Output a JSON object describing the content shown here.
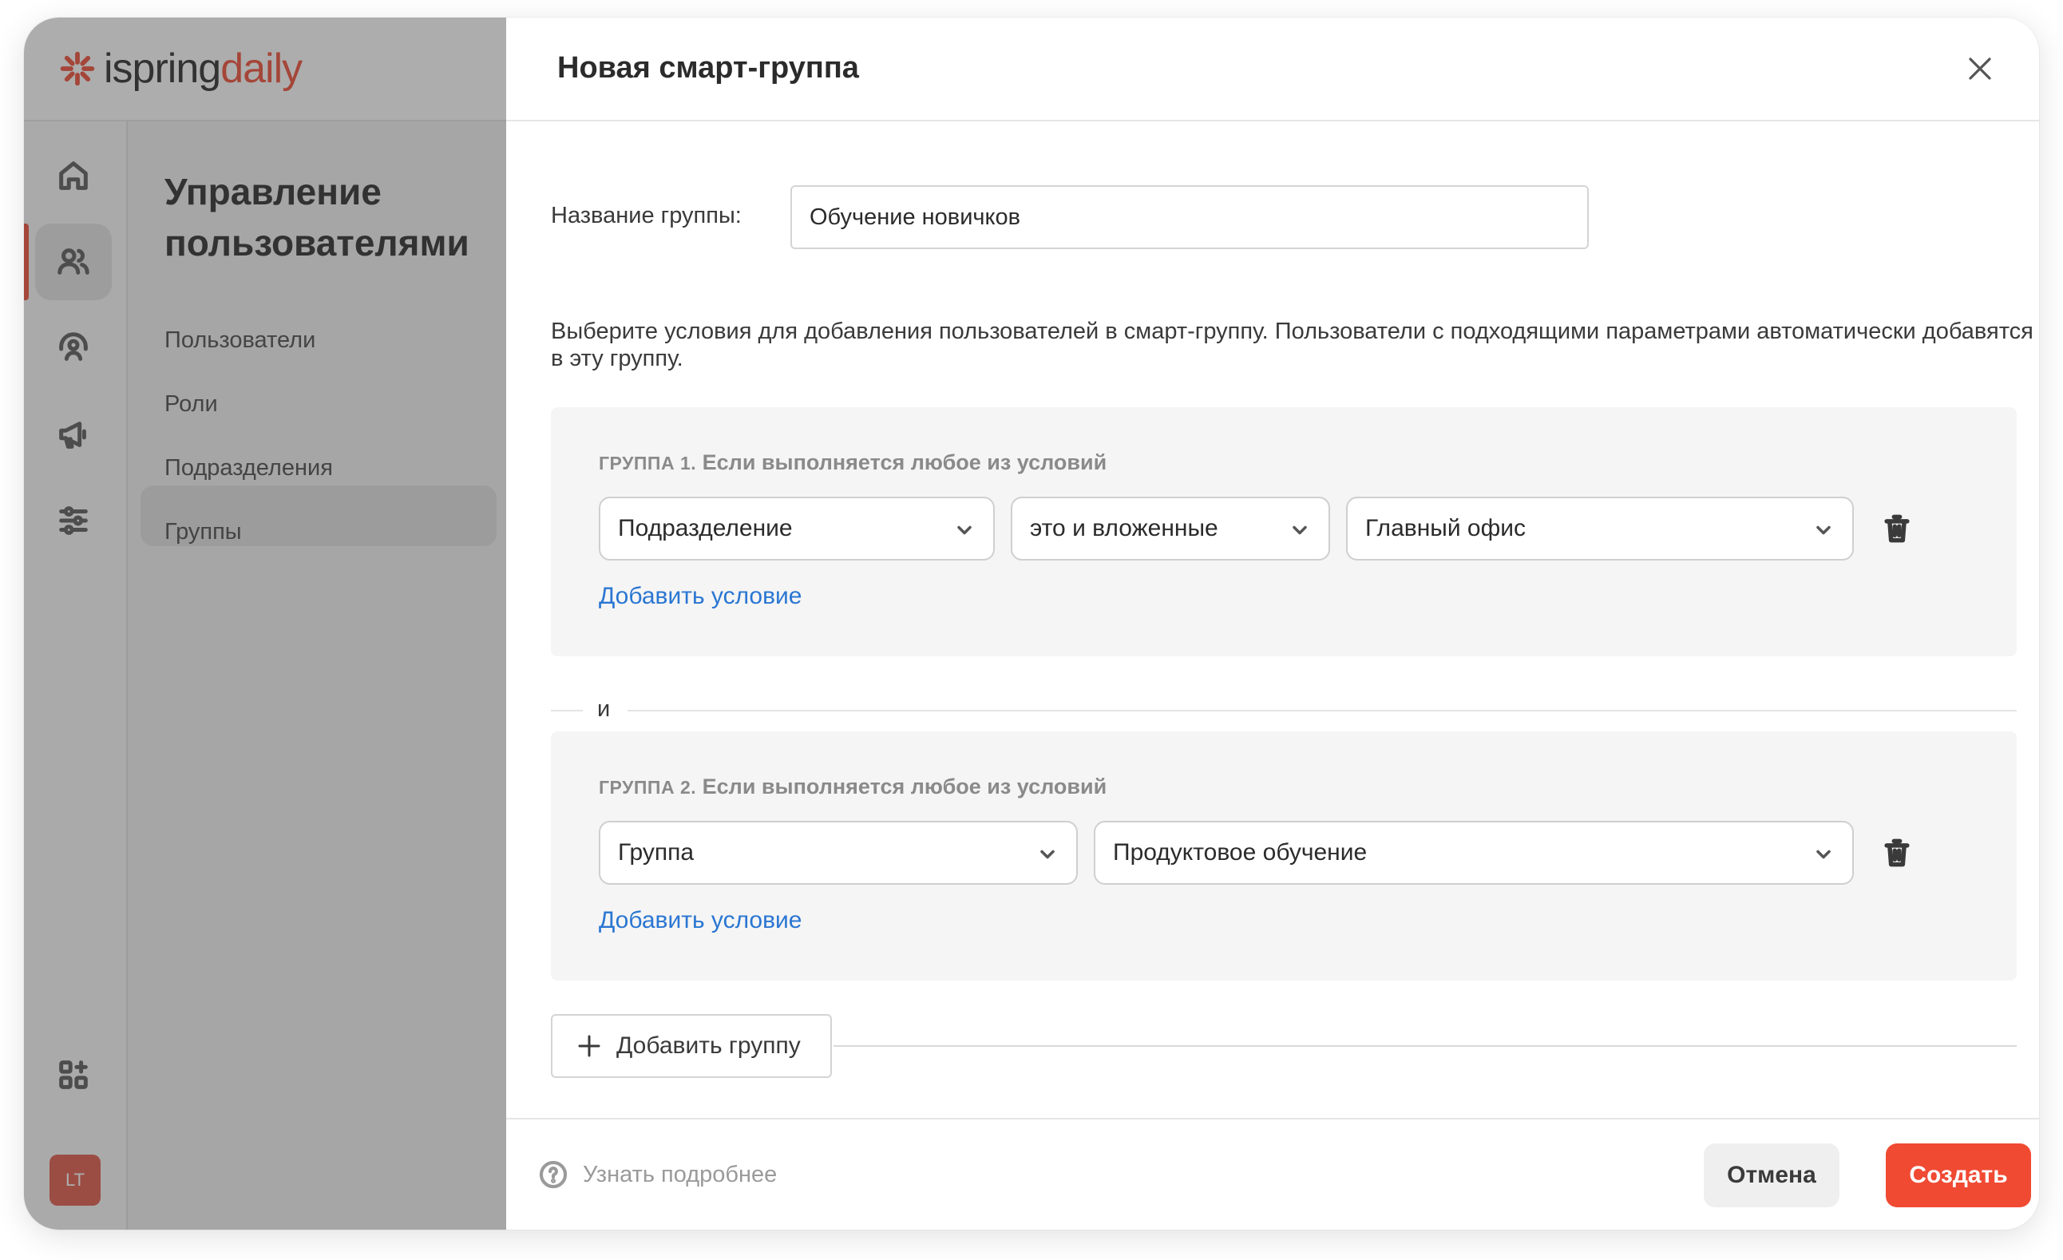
{
  "brand": {
    "name_part1": "ispring",
    "name_part2": "daily",
    "accent_color": "#ef4f38"
  },
  "rail": {
    "items": [
      {
        "icon": "home-icon",
        "active": false
      },
      {
        "icon": "users-icon",
        "active": true
      },
      {
        "icon": "training-icon",
        "active": false
      },
      {
        "icon": "megaphone-icon",
        "active": false
      },
      {
        "icon": "sliders-icon",
        "active": false
      }
    ],
    "apps_icon": "apps-add-icon",
    "avatar_initials": "LT"
  },
  "nav": {
    "title": "Управление пользователями",
    "items": [
      {
        "label": "Пользователи",
        "active": false
      },
      {
        "label": "Роли",
        "active": false
      },
      {
        "label": "Подразделения",
        "active": false
      },
      {
        "label": "Группы",
        "active": true
      }
    ]
  },
  "modal": {
    "title": "Новая смарт-группа",
    "name_label": "Название группы:",
    "name_value": "Обучение новичков",
    "description": "Выберите условия для добавления пользователей в смарт-группу. Пользователи с подходящими параметрами автоматически добавятся в эту группу.",
    "groups": [
      {
        "label_caps": "ГРУППА 1.",
        "label_rest": " Если выполняется любое из условий",
        "conditions": [
          "Подразделение",
          "это и вложенные",
          "Главный офис"
        ],
        "add_condition": "Добавить условие"
      },
      {
        "label_caps": "ГРУППА 2.",
        "label_rest": " Если выполняется любое из условий",
        "conditions": [
          "Группа",
          "Продуктовое обучение"
        ],
        "add_condition": "Добавить условие"
      }
    ],
    "and_label": "и",
    "add_group": "Добавить группу",
    "footer": {
      "learn_more": "Узнать подробнее",
      "cancel": "Отмена",
      "create": "Создать",
      "create_color": "#f04a33"
    }
  }
}
